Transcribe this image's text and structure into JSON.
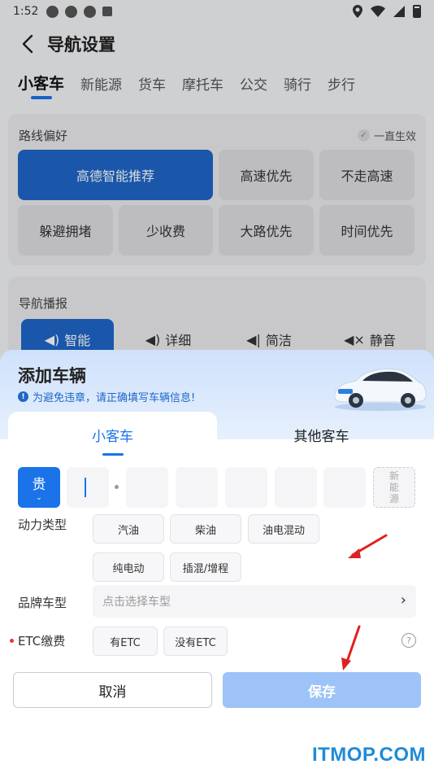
{
  "status_bar": {
    "time": "1:52"
  },
  "header": {
    "title": "导航设置"
  },
  "tabs": [
    "小客车",
    "新能源",
    "货车",
    "摩托车",
    "公交",
    "骑行",
    "步行"
  ],
  "route_pref": {
    "title": "路线偏好",
    "always_on": "一直生效",
    "options": [
      "高德智能推荐",
      "高速优先",
      "不走高速",
      "躲避拥堵",
      "少收费",
      "大路优先",
      "时间优先"
    ]
  },
  "voice": {
    "title": "导航播报",
    "options": [
      "智能",
      "详细",
      "简洁",
      "静音"
    ]
  },
  "sheet": {
    "title": "添加车辆",
    "notice": "为避免违章，请正确填写车辆信息!",
    "vehicle_tabs": [
      "小客车",
      "其他客车"
    ],
    "plate": {
      "province": "贵",
      "new_energy": [
        "新",
        "能",
        "源"
      ]
    },
    "power": {
      "label": "动力类型",
      "options": [
        "汽油",
        "柴油",
        "油电混动",
        "纯电动",
        "插混/增程"
      ]
    },
    "brand": {
      "label": "品牌车型",
      "placeholder": "点击选择车型"
    },
    "etc": {
      "label": "ETC缴费",
      "options": [
        "有ETC",
        "没有ETC"
      ]
    },
    "cancel": "取消",
    "save": "保存"
  },
  "watermark": "ITMOP.COM",
  "colors": {
    "accent": "#1a73e8",
    "selected": "#1f67c9",
    "save_disabled": "#9dc3f8",
    "arrow": "#e02020"
  }
}
